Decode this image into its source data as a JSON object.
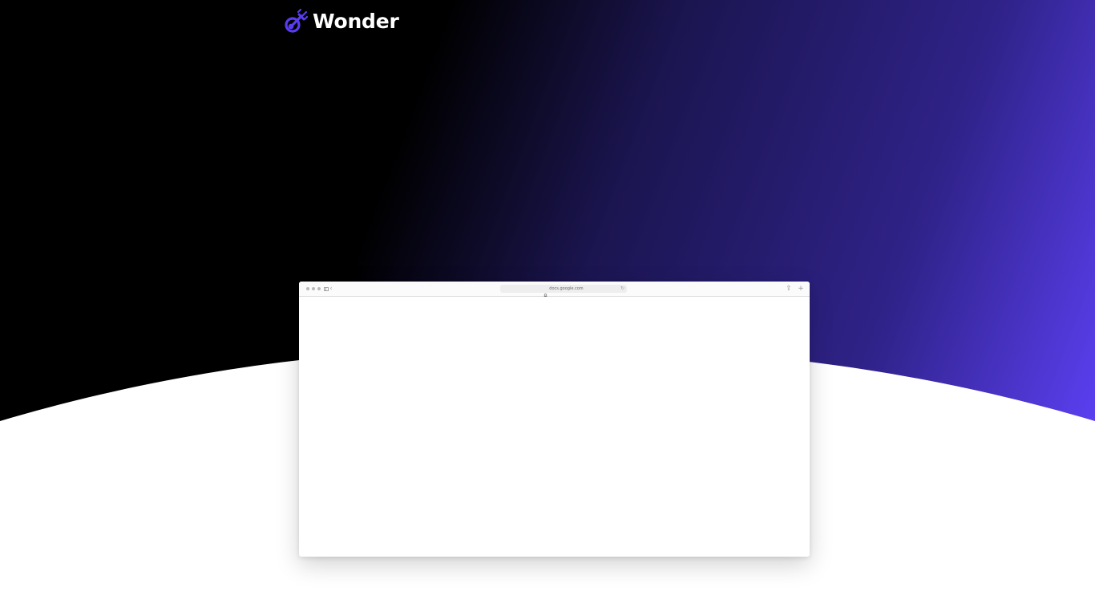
{
  "brand": {
    "name": "Wonder",
    "icon": "comet-icon",
    "accent_color": "#5a3cf0"
  },
  "background": {
    "gradient_start": "#000000",
    "gradient_mid": "#1e1758",
    "gradient_end": "#5a3ff0",
    "lower_color": "#ffffff"
  },
  "browser": {
    "url": "docs.google.com",
    "icons": {
      "close": "close-dot-icon",
      "minimize": "minimize-dot-icon",
      "maximize": "maximize-dot-icon",
      "sidebar": "sidebar-toggle-icon",
      "back": "back-chevron-icon",
      "lock": "lock-icon",
      "reload": "reload-icon",
      "share": "share-icon",
      "new_tab": "plus-icon"
    },
    "glyphs": {
      "back": "‹",
      "reload": "↻",
      "share": "⇪",
      "new_tab": "+"
    }
  }
}
